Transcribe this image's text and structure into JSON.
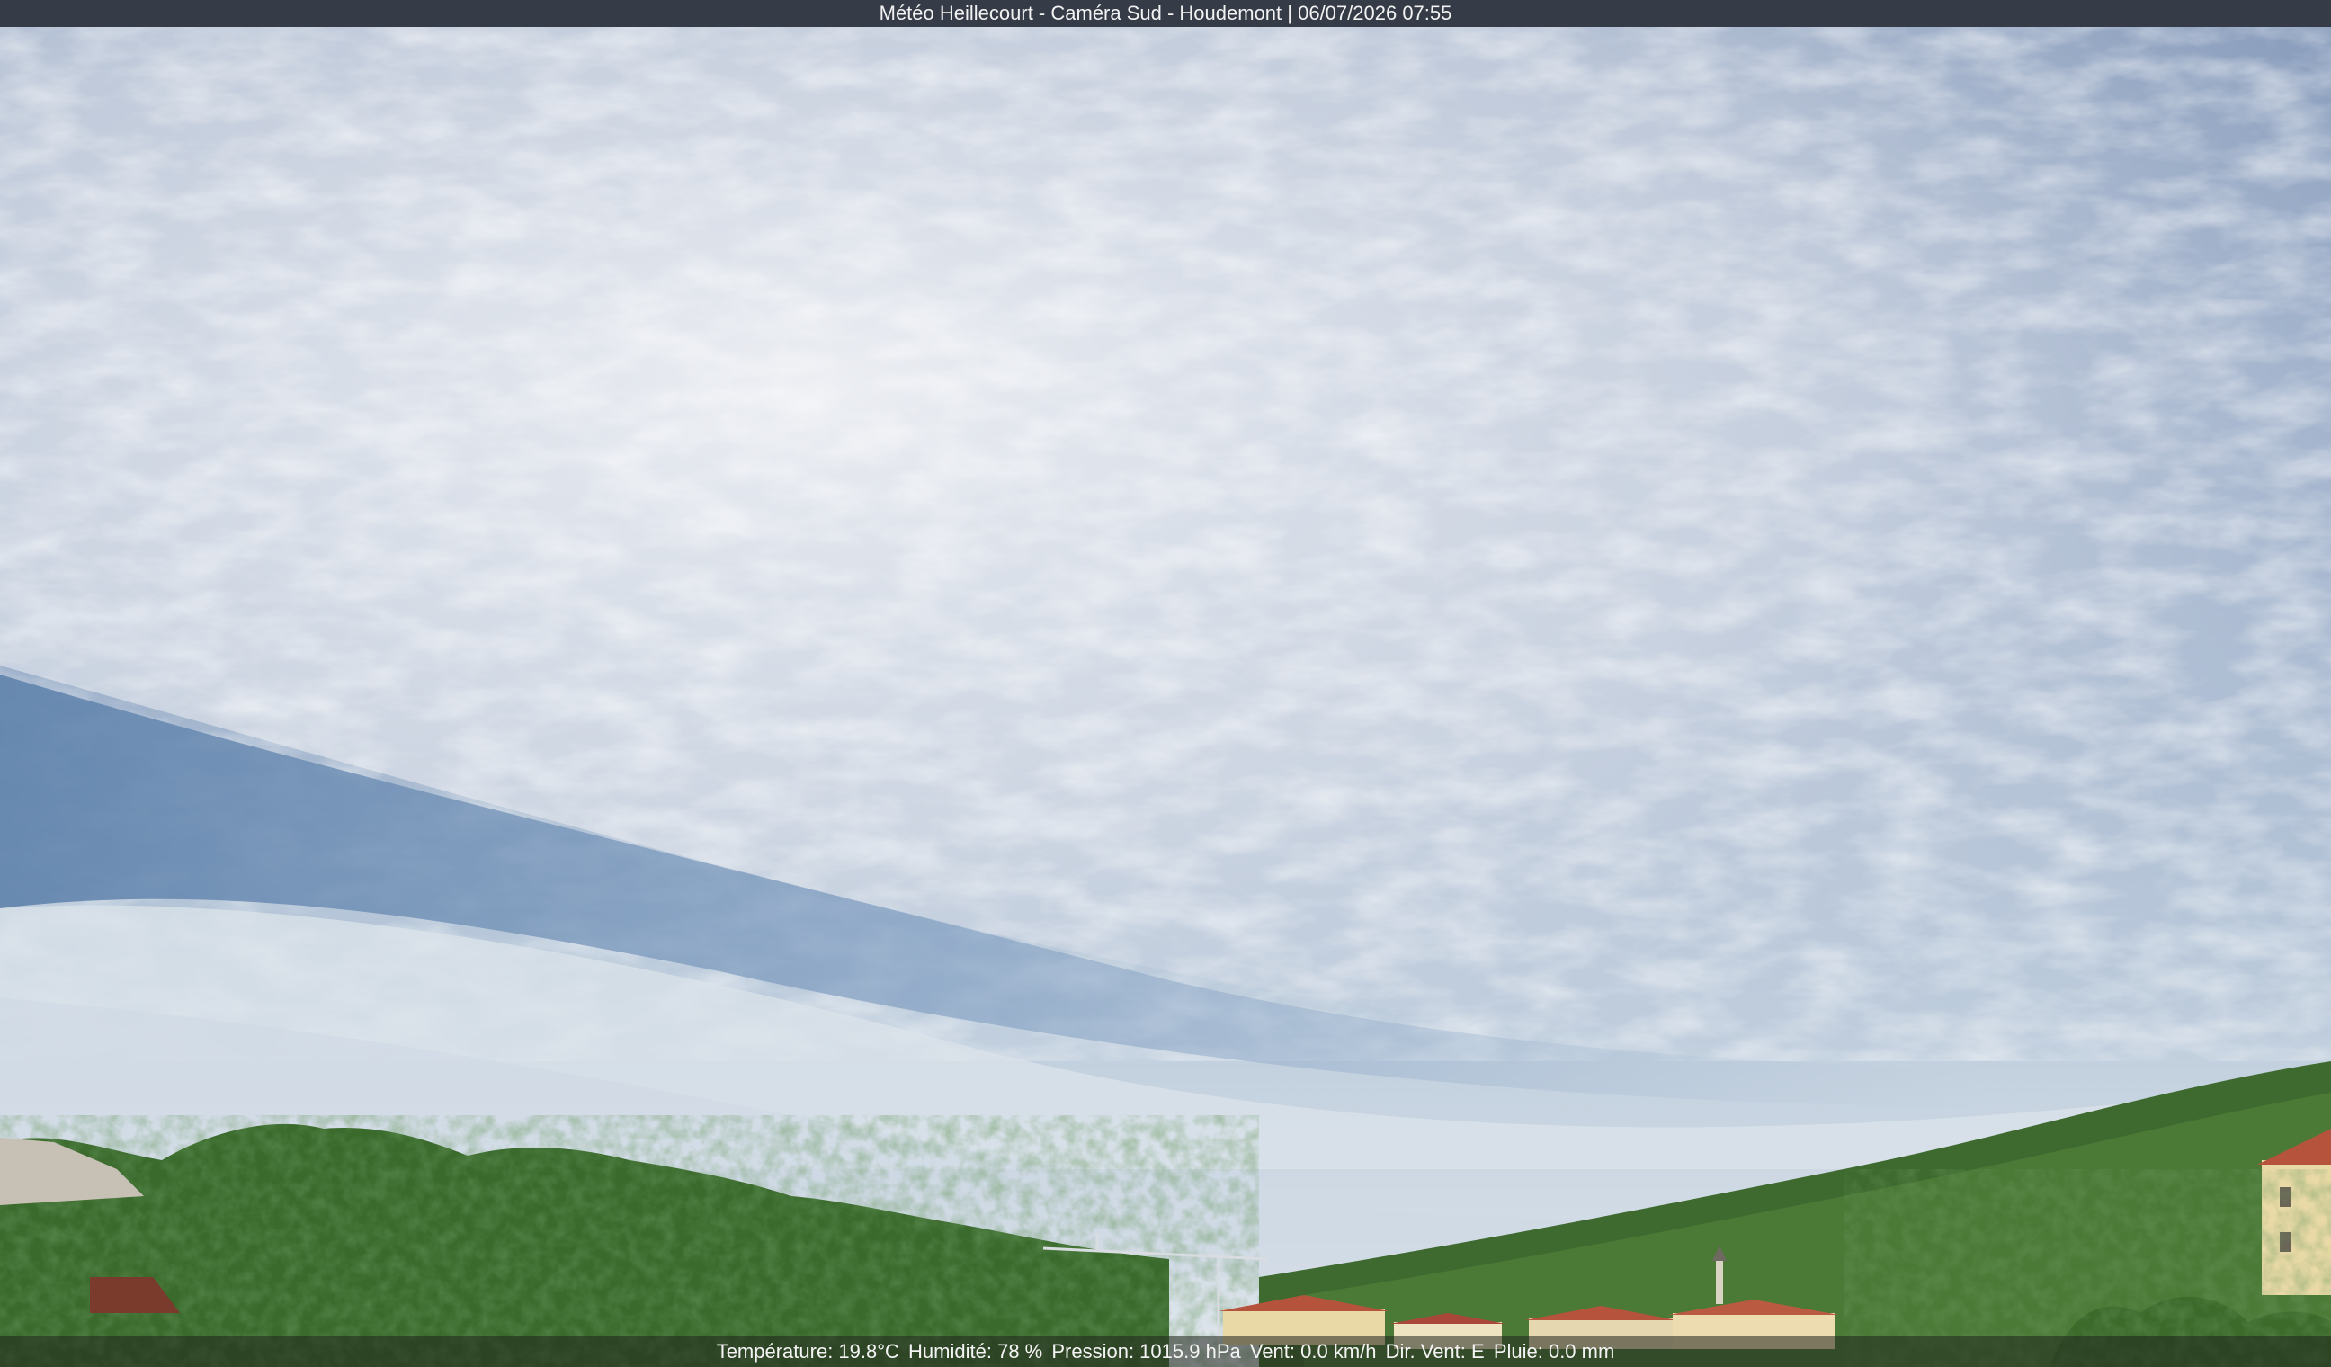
{
  "overlay": {
    "title": "Météo Heillecourt - Caméra Sud - Houdemont | 06/07/2026 07:55",
    "weather": {
      "temperature": "Température: 19.8°C",
      "humidity": "Humidité: 78 %",
      "pressure": "Pression: 1015.9 hPa",
      "wind_speed": "Vent: 0.0 km/h",
      "wind_dir": "Dir. Vent: E",
      "rain": "Pluie: 0.0 mm"
    }
  },
  "colors": {
    "sky_top": "#7c93b7",
    "sky_horizon": "#dbe3ea",
    "cloud": "#e8ebf0",
    "vegetation": "#3d6b2e",
    "roof": "#b5533d",
    "house_wall": "#e8d9a6"
  }
}
